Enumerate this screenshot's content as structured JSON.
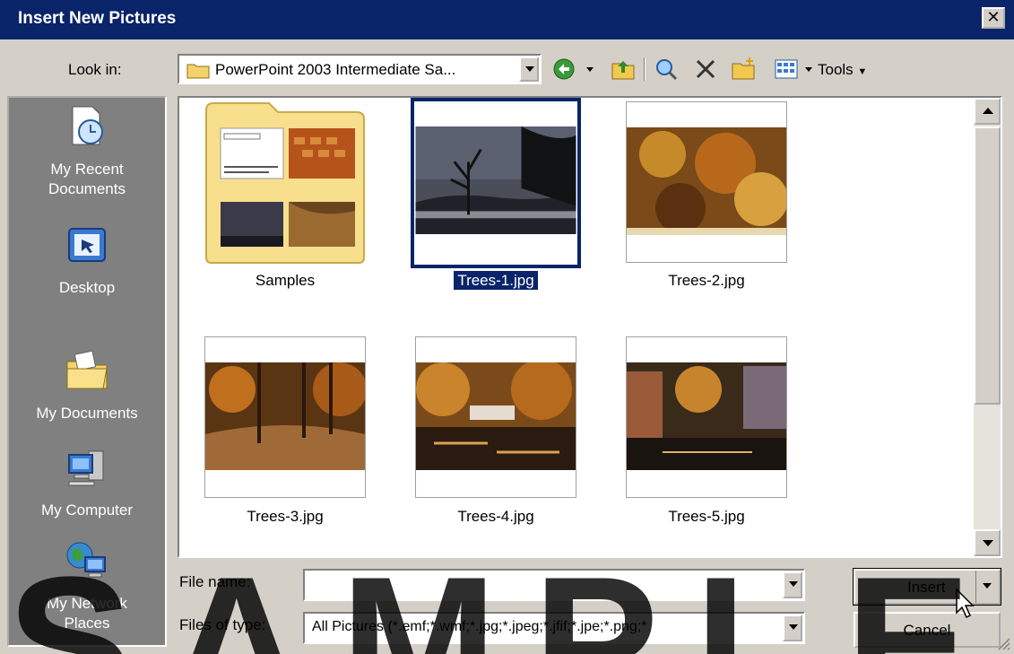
{
  "window": {
    "title": "Insert New Pictures"
  },
  "toolbar": {
    "look_in_label": "Look in:",
    "look_in_value": "PowerPoint 2003 Intermediate Sa...",
    "tools_label": "Tools"
  },
  "places": [
    {
      "label1": "My Recent",
      "label2": "Documents",
      "icon": "recent-documents-icon"
    },
    {
      "label1": "Desktop",
      "label2": "",
      "icon": "desktop-icon"
    },
    {
      "label1": "My Documents",
      "label2": "",
      "icon": "my-documents-icon"
    },
    {
      "label1": "My Computer",
      "label2": "",
      "icon": "my-computer-icon"
    },
    {
      "label1": "My Network",
      "label2": "Places",
      "icon": "network-places-icon"
    }
  ],
  "files": [
    {
      "name": "Samples",
      "type": "folder",
      "selected": false
    },
    {
      "name": "Trees-1.jpg",
      "type": "image",
      "selected": true
    },
    {
      "name": "Trees-2.jpg",
      "type": "image",
      "selected": false
    },
    {
      "name": "Trees-3.jpg",
      "type": "image",
      "selected": false
    },
    {
      "name": "Trees-4.jpg",
      "type": "image",
      "selected": false
    },
    {
      "name": "Trees-5.jpg",
      "type": "image",
      "selected": false
    }
  ],
  "form": {
    "file_name_label": "File name:",
    "file_name_value": "",
    "files_of_type_label": "Files of type:",
    "files_of_type_value": "All Pictures (*.emf;*.wmf;*.jpg;*.jpeg;*.jfif;*.jpe;*.png;*"
  },
  "buttons": {
    "insert": "Insert",
    "cancel": "Cancel"
  },
  "watermark": "SAMPLE",
  "colors": {
    "titlebar": "#0a246a",
    "dialog": "#d4d0c8",
    "selection": "#0a246a"
  }
}
